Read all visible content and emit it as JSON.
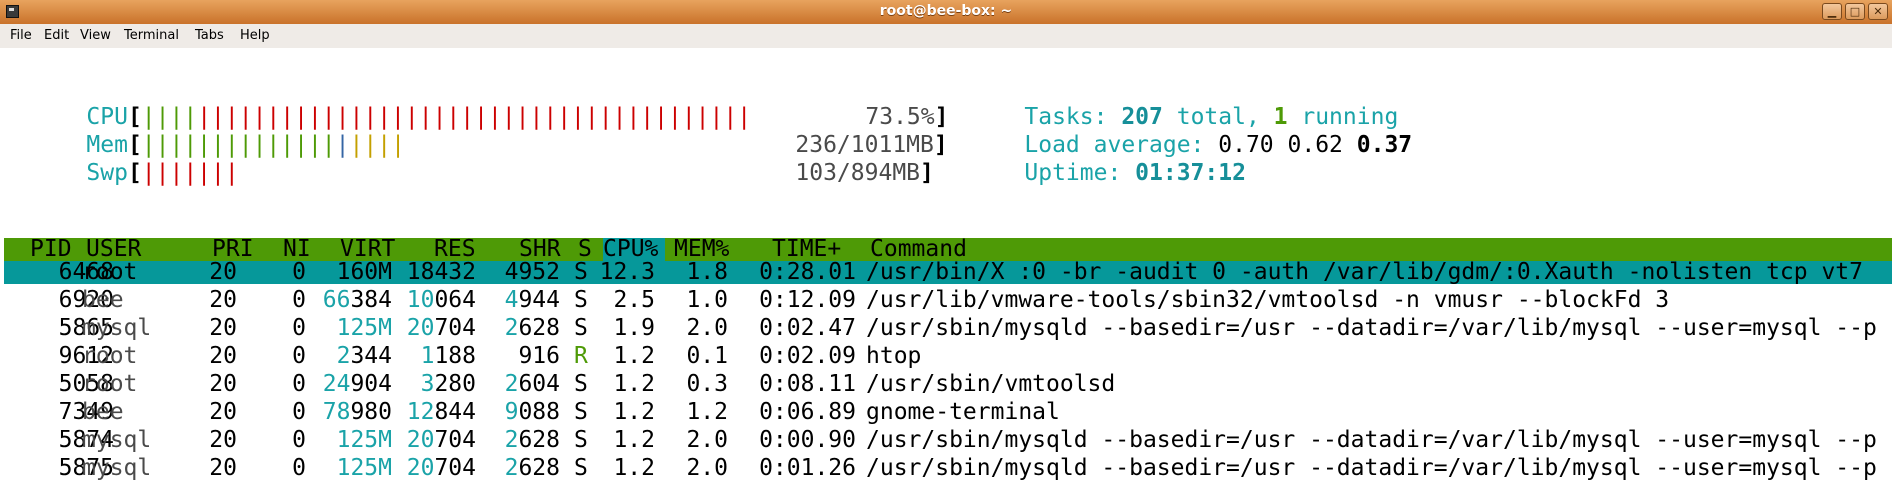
{
  "window": {
    "title": "root@bee-box: ~",
    "buttons": [
      "minimize-icon",
      "maximize-icon",
      "close-icon"
    ]
  },
  "menu": [
    "File",
    "Edit",
    "View",
    "Terminal",
    "Tabs",
    "Help"
  ],
  "meters": {
    "cpu": {
      "label": "CPU",
      "value": "73.5%",
      "bars": {
        "green": 4,
        "red": 40
      }
    },
    "mem": {
      "label": "Mem",
      "value": "236/1011MB",
      "bars": {
        "green": 14,
        "blue": 1,
        "yellow": 4
      }
    },
    "swp": {
      "label": "Swp",
      "value": "103/894MB",
      "bars": {
        "red": 7
      }
    }
  },
  "summary": {
    "tasks_label": "Tasks: ",
    "tasks_total": "207",
    "tasks_total_suffix": " total, ",
    "tasks_running": "1",
    "tasks_running_suffix": " running",
    "load_label": "Load average: ",
    "load1": "0.70",
    "load5": "0.62",
    "load15": "0.37",
    "uptime_label": "Uptime: ",
    "uptime": "01:37:12"
  },
  "columns": [
    "PID",
    "USER",
    "PRI",
    "NI",
    "VIRT",
    "RES",
    "SHR",
    "S",
    "CPU%",
    "MEM%",
    "TIME+",
    "Command"
  ],
  "sorted_column": "CPU%",
  "processes": [
    {
      "pid": "6468",
      "user": "root",
      "pri": "20",
      "ni": "0",
      "virt": "160M",
      "res": "18432",
      "shr": "4952",
      "s": "S",
      "cpu": "12.3",
      "mem": "1.8",
      "time": "0:28.01",
      "cmd": "/usr/bin/X :0 -br -audit 0 -auth /var/lib/gdm/:0.Xauth -nolisten tcp vt7",
      "selected": true
    },
    {
      "pid": "6920",
      "user": "bee",
      "pri": "20",
      "ni": "0",
      "virt": "66384",
      "res": "10064",
      "shr": "4944",
      "s": "S",
      "cpu": "2.5",
      "mem": "1.0",
      "time": "0:12.09",
      "cmd": "/usr/lib/vmware-tools/sbin32/vmtoolsd -n vmusr --blockFd 3"
    },
    {
      "pid": "5865",
      "user": "mysql",
      "pri": "20",
      "ni": "0",
      "virt": "125M",
      "res": "20704",
      "shr": "2628",
      "s": "S",
      "cpu": "1.9",
      "mem": "2.0",
      "time": "0:02.47",
      "cmd": "/usr/sbin/mysqld --basedir=/usr --datadir=/var/lib/mysql --user=mysql --p"
    },
    {
      "pid": "9612",
      "user": "root",
      "pri": "20",
      "ni": "0",
      "virt": "2344",
      "res": "1188",
      "shr": "916",
      "s": "R",
      "cpu": "1.2",
      "mem": "0.1",
      "time": "0:02.09",
      "cmd": "htop"
    },
    {
      "pid": "5058",
      "user": "root",
      "pri": "20",
      "ni": "0",
      "virt": "24904",
      "res": "3280",
      "shr": "2604",
      "s": "S",
      "cpu": "1.2",
      "mem": "0.3",
      "time": "0:08.11",
      "cmd": "/usr/sbin/vmtoolsd"
    },
    {
      "pid": "7349",
      "user": "bee",
      "pri": "20",
      "ni": "0",
      "virt": "78980",
      "res": "12844",
      "shr": "9088",
      "s": "S",
      "cpu": "1.2",
      "mem": "1.2",
      "time": "0:06.89",
      "cmd": "gnome-terminal"
    },
    {
      "pid": "5874",
      "user": "mysql",
      "pri": "20",
      "ni": "0",
      "virt": "125M",
      "res": "20704",
      "shr": "2628",
      "s": "S",
      "cpu": "1.2",
      "mem": "2.0",
      "time": "0:00.90",
      "cmd": "/usr/sbin/mysqld --basedir=/usr --datadir=/var/lib/mysql --user=mysql --p"
    },
    {
      "pid": "5875",
      "user": "mysql",
      "pri": "20",
      "ni": "0",
      "virt": "125M",
      "res": "20704",
      "shr": "2628",
      "s": "S",
      "cpu": "1.2",
      "mem": "2.0",
      "time": "0:01.26",
      "cmd": "/usr/sbin/mysqld --basedir=/usr --datadir=/var/lib/mysql --user=mysql --p"
    }
  ],
  "colors": {
    "titlebar": "#d98a45",
    "header_bg": "#4e9a06",
    "selected_bg": "#06989a",
    "cyan_text": "#1aa3a8"
  }
}
